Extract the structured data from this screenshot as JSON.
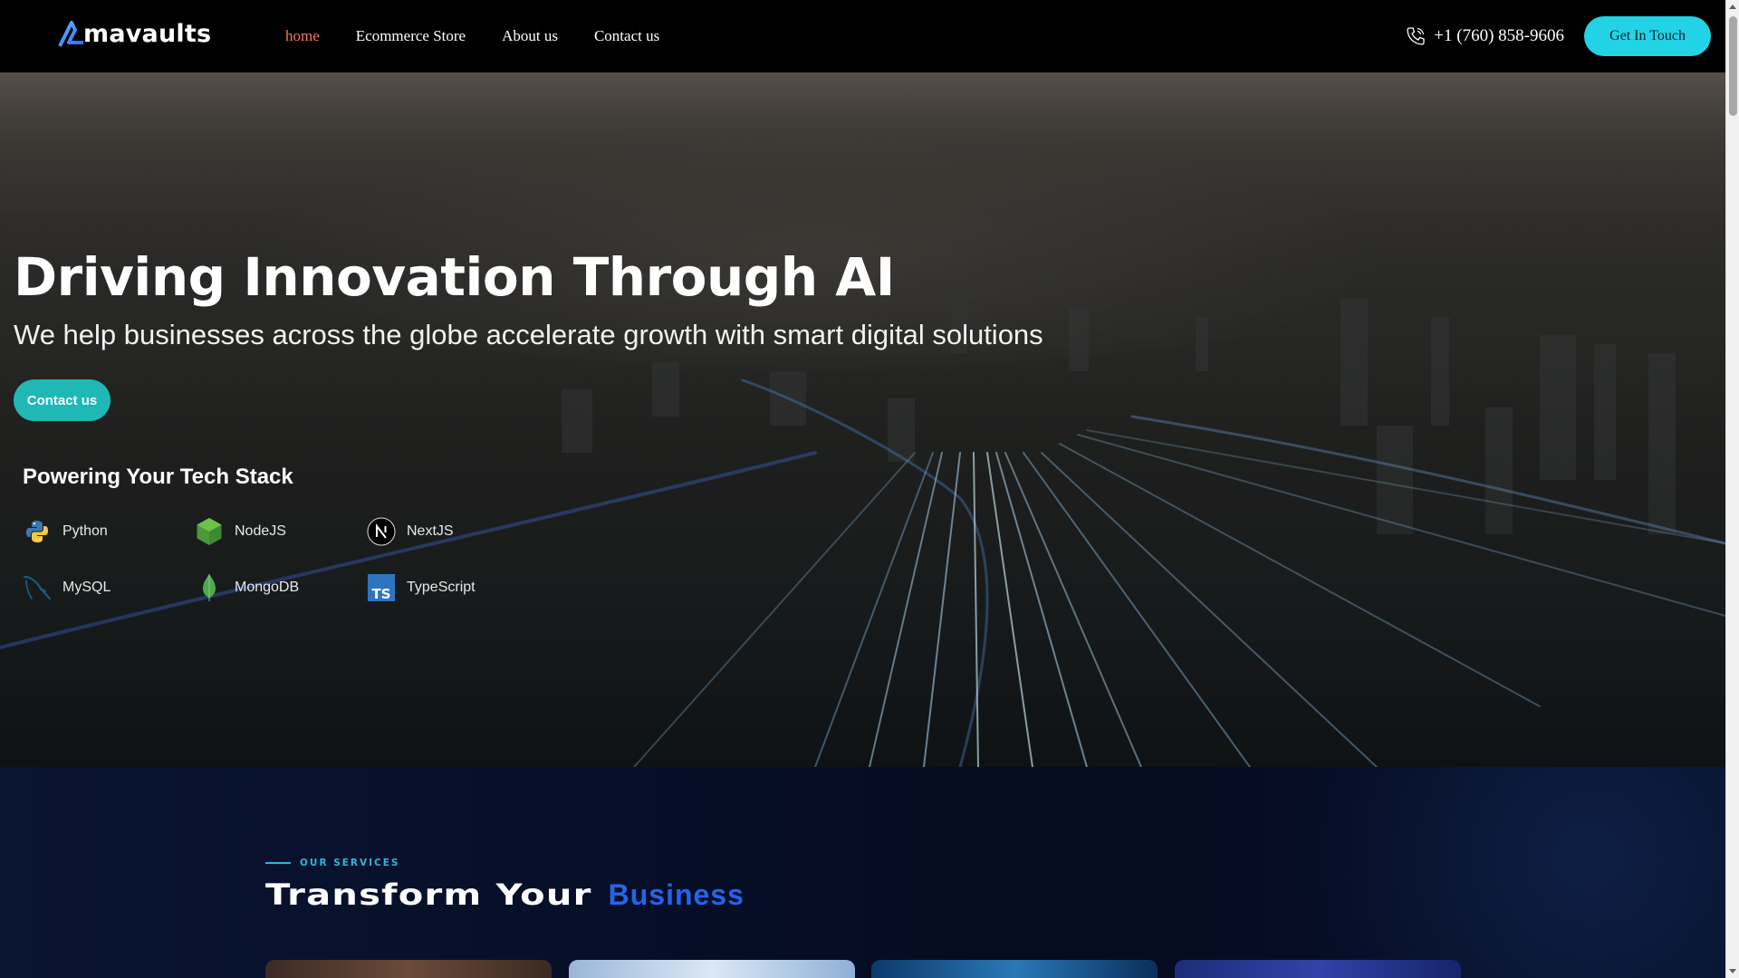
{
  "header": {
    "logo_text": "mavaults",
    "nav": [
      {
        "label": "home",
        "active": true
      },
      {
        "label": "Ecommerce Store",
        "active": false
      },
      {
        "label": "About us",
        "active": false
      },
      {
        "label": "Contact us",
        "active": false
      }
    ],
    "phone": "+1 (760) 858-9606",
    "cta_label": "Get In Touch"
  },
  "hero": {
    "title": "Driving Innovation Through AI",
    "subtitle": "We help businesses across the globe accelerate growth with smart digital solutions",
    "button_label": "Contact us",
    "stack_title": "Powering Your Tech Stack",
    "stack": [
      {
        "name": "Python",
        "icon": "python-icon"
      },
      {
        "name": "NodeJS",
        "icon": "nodejs-icon"
      },
      {
        "name": "NextJS",
        "icon": "nextjs-icon"
      },
      {
        "name": "MySQL",
        "icon": "mysql-icon"
      },
      {
        "name": "MongoDB",
        "icon": "mongodb-icon"
      },
      {
        "name": "TypeScript",
        "icon": "typescript-icon"
      }
    ]
  },
  "services": {
    "eyebrow": "OUR SERVICES",
    "title_part1": "Transform Your",
    "title_part2": "Business"
  },
  "colors": {
    "accent": "#22d3e6",
    "nav_active": "#f07a5a",
    "hero_button": "#1fb8b5",
    "business_blue": "#2563eb"
  }
}
